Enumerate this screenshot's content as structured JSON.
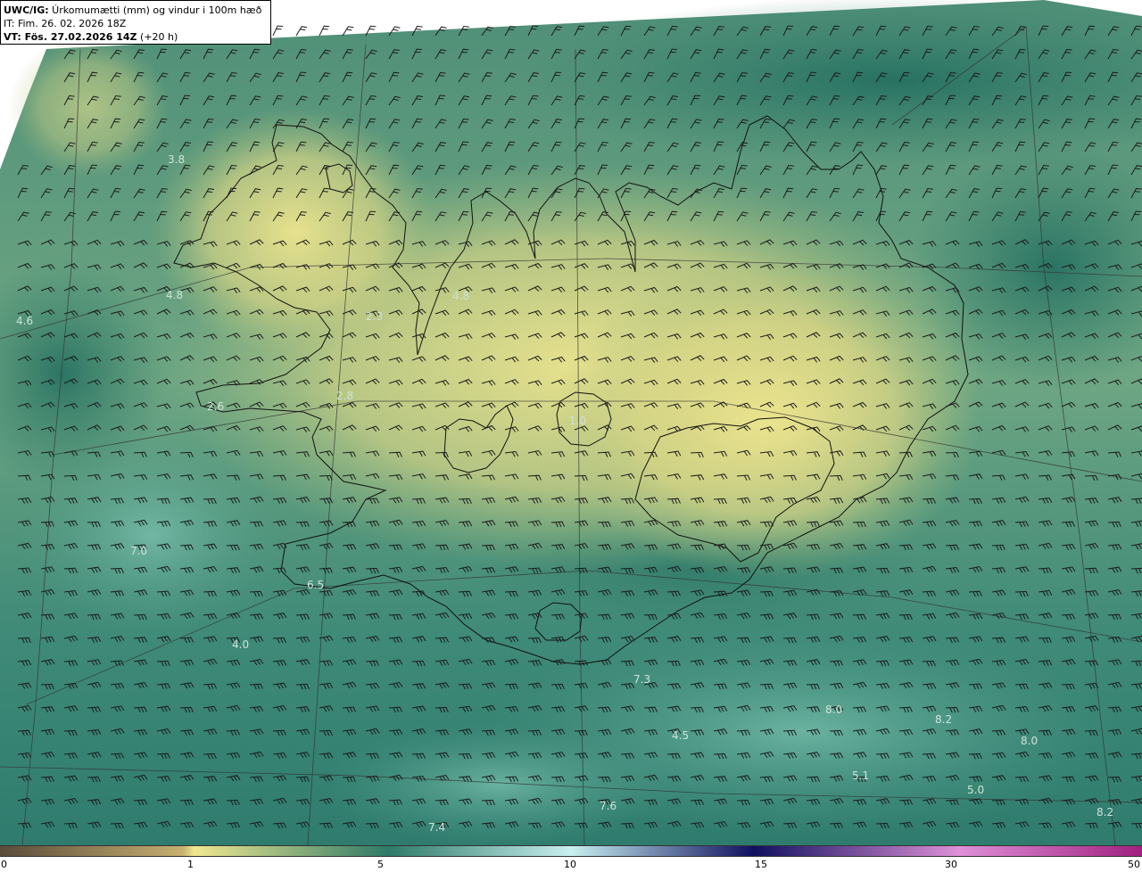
{
  "title": {
    "product": "UWC/IG:",
    "description": " Úrkomumætti (mm) og vindur i 100m hæð",
    "init_time": "IT: Fim. 26. 02. 2026 18Z",
    "valid_label": "VT: Fös. 27.02.2026 14Z",
    "lead": " (+20 h)"
  },
  "colorbar": {
    "ticks": [
      "0",
      "1",
      "5",
      "10",
      "15",
      "30",
      "50"
    ],
    "colors": [
      "#5a4a3a",
      "#c8b070",
      "#f0e890",
      "#2e7a68",
      "#c8f0f0",
      "#101060",
      "#e090d8",
      "#a02080"
    ]
  },
  "values": [
    {
      "label": "3.8",
      "name": "value-label-3-8"
    },
    {
      "label": "4.8",
      "name": "value-label-4-8-west"
    },
    {
      "label": "4.6",
      "name": "value-label-4-6"
    },
    {
      "label": "2.3",
      "name": "value-label-2-3"
    },
    {
      "label": "4.8",
      "name": "value-label-4-8-north"
    },
    {
      "label": "2.8",
      "name": "value-label-2-8"
    },
    {
      "label": "2.6",
      "name": "value-label-2-6"
    },
    {
      "label": "1.0",
      "name": "value-label-1-0"
    },
    {
      "label": "7.0",
      "name": "value-label-7-0"
    },
    {
      "label": "6.5",
      "name": "value-label-6-5"
    },
    {
      "label": "4.0",
      "name": "value-label-4-0"
    },
    {
      "label": "7.3",
      "name": "value-label-7-3"
    },
    {
      "label": "8.0",
      "name": "value-label-8-0-a"
    },
    {
      "label": "8.2",
      "name": "value-label-8-2-a"
    },
    {
      "label": "8.0",
      "name": "value-label-8-0-b"
    },
    {
      "label": "4.5",
      "name": "value-label-4-5"
    },
    {
      "label": "5.1",
      "name": "value-label-5-1"
    },
    {
      "label": "5.0",
      "name": "value-label-5-0"
    },
    {
      "label": "7.6",
      "name": "value-label-7-6"
    },
    {
      "label": "7.4",
      "name": "value-label-7-4"
    },
    {
      "label": "8.2",
      "name": "value-label-8-2-b"
    }
  ]
}
